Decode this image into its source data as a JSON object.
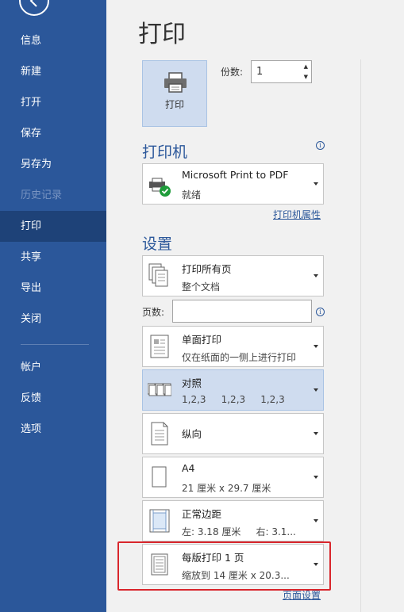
{
  "sidebar": {
    "items": [
      {
        "label": "信息"
      },
      {
        "label": "新建"
      },
      {
        "label": "打开"
      },
      {
        "label": "保存"
      },
      {
        "label": "另存为"
      },
      {
        "label": "历史记录"
      },
      {
        "label": "打印"
      },
      {
        "label": "共享"
      },
      {
        "label": "导出"
      },
      {
        "label": "关闭"
      },
      {
        "label": "帐户"
      },
      {
        "label": "反馈"
      },
      {
        "label": "选项"
      }
    ]
  },
  "main": {
    "title": "打印",
    "print_button": "打印",
    "copies_label": "份数:",
    "copies_value": "1",
    "printer_heading": "打印机",
    "printer": {
      "name": "Microsoft Print to PDF",
      "status": "就绪"
    },
    "printer_props_link": "打印机属性",
    "settings_heading": "设置",
    "settings": [
      {
        "line1": "打印所有页",
        "line2": "整个文档"
      },
      {
        "line1": "单面打印",
        "line2": "仅在纸面的一侧上进行打印"
      },
      {
        "line1": "对照",
        "line2": "1,2,3     1,2,3     1,2,3"
      },
      {
        "line1": "纵向",
        "line2": ""
      },
      {
        "line1": "A4",
        "line2": "21 厘米 x 29.7 厘米"
      },
      {
        "line1": "正常边距",
        "line2": "左: 3.18 厘米     右: 3.1..."
      },
      {
        "line1": "每版打印 1 页",
        "line2": "缩放到 14 厘米 x 20.3..."
      }
    ],
    "pages_label": "页数:",
    "pages_value": "",
    "page_setup_link": "页面设置",
    "info_icon": "i"
  }
}
